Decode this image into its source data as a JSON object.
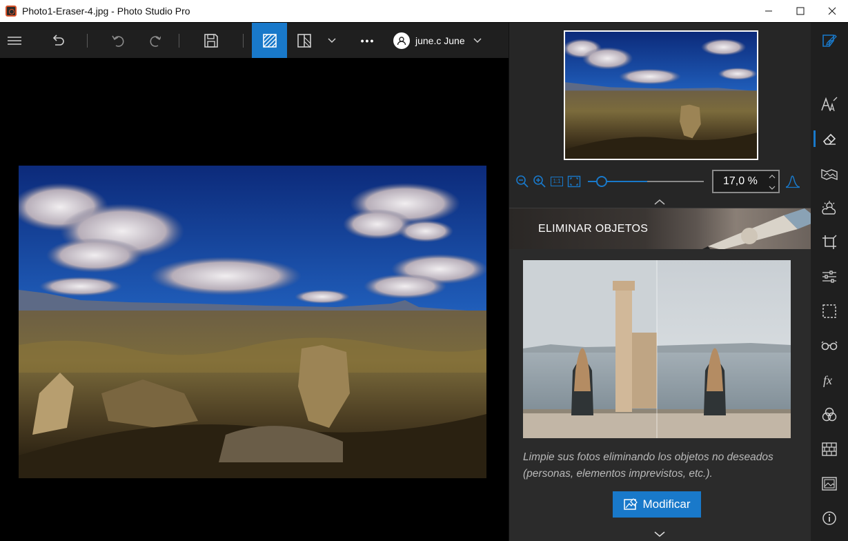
{
  "window": {
    "title": "Photo1-Eraser-4.jpg - Photo Studio Pro",
    "minimize": "—",
    "maximize": "☐",
    "close": "✕"
  },
  "toolbar": {
    "items": [
      "menu-icon",
      "undo-all-icon",
      "undo-icon",
      "redo-icon",
      "save-icon",
      "compare-icon",
      "split-view-icon",
      "chevron-down-icon",
      "more-icon"
    ],
    "more_label": "•••",
    "user_name": "june.c June"
  },
  "navigator": {
    "zoom_value": "17,0 %",
    "one_to_one": "1:1"
  },
  "section": {
    "title": "ELIMINAR OBJETOS",
    "description": "Limpie sus fotos eliminando los objetos no deseados (personas, elementos imprevistos, etc.).",
    "modify_label": "Modificar"
  },
  "rail": {
    "items": [
      "edit-note-icon",
      "text-style-icon",
      "eraser-icon",
      "landscape-icon",
      "weather-icon",
      "crop-icon",
      "adjust-icon",
      "selection-icon",
      "glasses-icon",
      "fx-icon",
      "color-blend-icon",
      "texture-icon",
      "picture-icon",
      "info-icon"
    ],
    "active": "eraser-icon"
  },
  "colors": {
    "accent": "#1979ca",
    "toolbar_bg": "#1f1f1f",
    "panel_bg": "#262626"
  }
}
